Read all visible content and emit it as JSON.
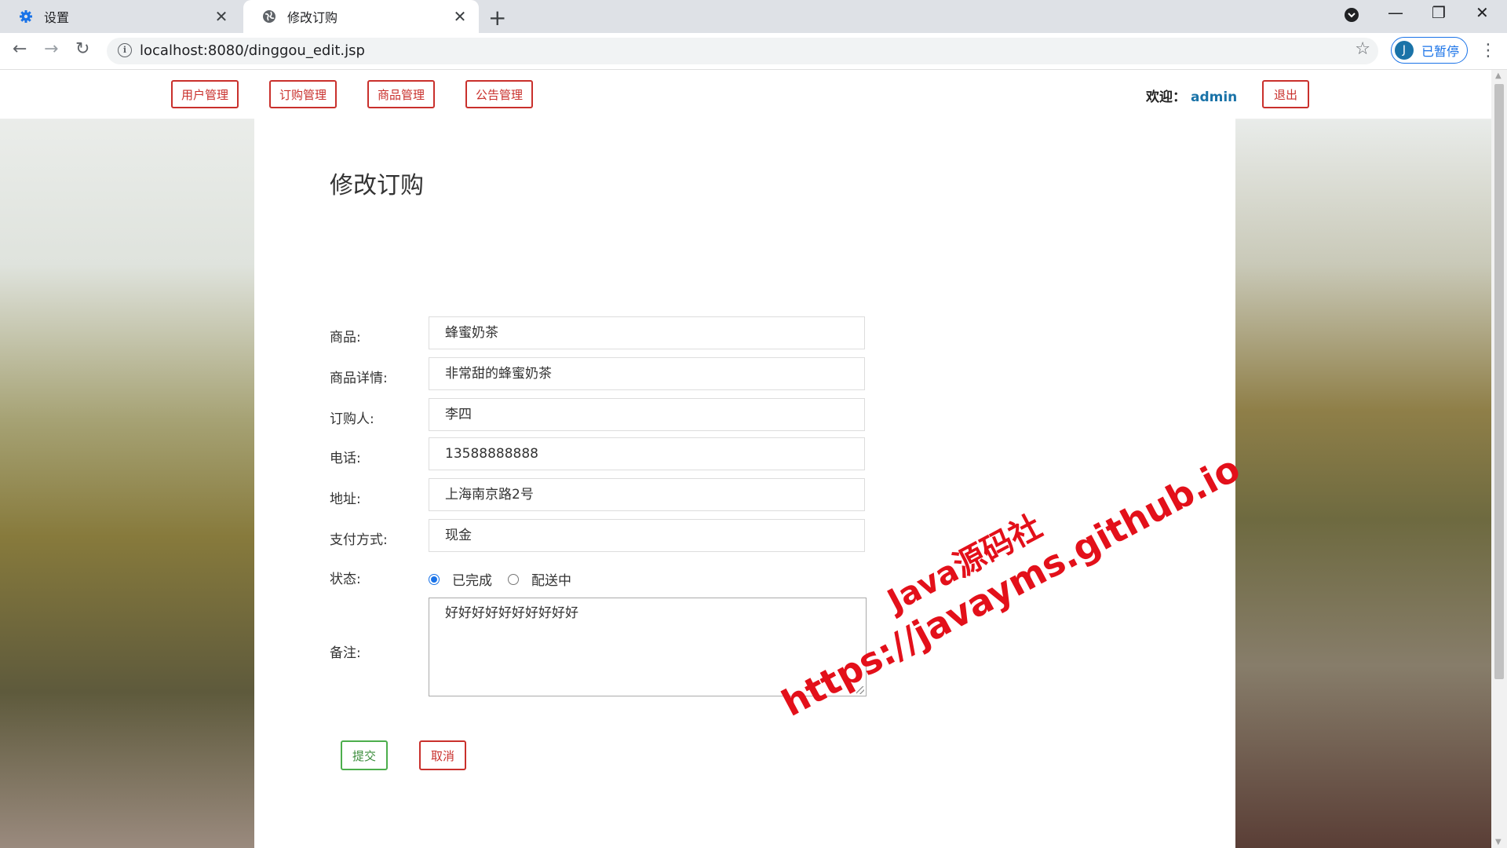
{
  "browser": {
    "tabs": [
      {
        "title": "设置",
        "icon": "gear-icon"
      },
      {
        "title": "修改订购",
        "icon": "globe-icon"
      }
    ],
    "url": "localhost:8080/dinggou_edit.jsp",
    "profile_initial": "J",
    "profile_status": "已暂停"
  },
  "nav": {
    "items": [
      "用户管理",
      "订购管理",
      "商品管理",
      "公告管理"
    ],
    "welcome_label": "欢迎：",
    "username": "admin",
    "logout": "退出"
  },
  "form": {
    "title": "修改订购",
    "fields": [
      {
        "label": "商品:",
        "value": "蜂蜜奶茶"
      },
      {
        "label": "商品详情:",
        "value": "非常甜的蜂蜜奶茶"
      },
      {
        "label": "订购人:",
        "value": "李四"
      },
      {
        "label": "电话:",
        "value": "13588888888"
      },
      {
        "label": "地址:",
        "value": "上海南京路2号"
      },
      {
        "label": "支付方式:",
        "value": "现金"
      }
    ],
    "status_label": "状态:",
    "status_options": [
      "已完成",
      "配送中"
    ],
    "status_selected": "已完成",
    "remark_label": "备注:",
    "remark_value": "好好好好好好好好好好",
    "submit": "提交",
    "cancel": "取消"
  },
  "watermark": {
    "line1": "Java源码社",
    "line2": "https://javayms.github.io"
  },
  "colors": {
    "danger": "#c9302c",
    "success": "#4cae4c",
    "accent": "#1a73e8",
    "watermark": "#e3101a"
  }
}
